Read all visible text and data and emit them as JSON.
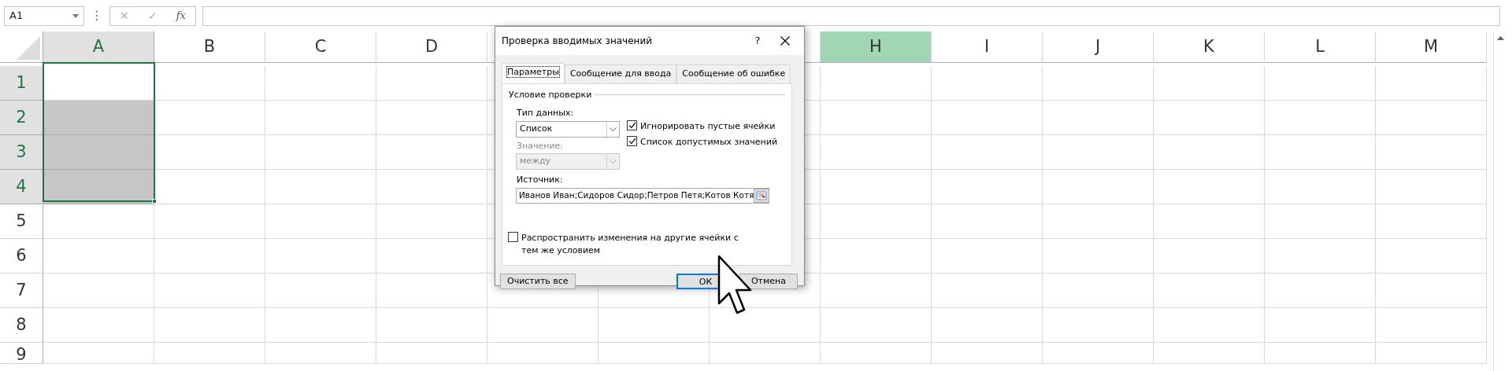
{
  "formula_bar": {
    "name_box": "A1",
    "cancel": "✕",
    "enter": "✓",
    "function": "fx",
    "more": "⋮"
  },
  "sheet": {
    "columns": [
      {
        "label": "A",
        "selected": true,
        "highlighted": false
      },
      {
        "label": "B",
        "selected": false,
        "highlighted": false
      },
      {
        "label": "C",
        "selected": false,
        "highlighted": false
      },
      {
        "label": "D",
        "selected": false,
        "highlighted": false
      },
      {},
      {},
      {
        "selected": false,
        "highlighted": false
      },
      {
        "label": "H",
        "selected": false,
        "highlighted": true
      },
      {
        "label": "I",
        "selected": false,
        "highlighted": false
      },
      {
        "label": "J",
        "selected": false,
        "highlighted": false
      },
      {
        "label": "K",
        "selected": false,
        "highlighted": false
      },
      {
        "label": "L",
        "selected": false,
        "highlighted": false
      },
      {
        "label": "M",
        "selected": false,
        "highlighted": false
      }
    ],
    "rows": [
      {
        "label": "1",
        "selected": true,
        "active": true
      },
      {
        "label": "2",
        "selected": true,
        "active": false
      },
      {
        "label": "3",
        "selected": true,
        "active": false
      },
      {
        "label": "4",
        "selected": true,
        "active": false
      },
      {
        "label": "5",
        "selected": false,
        "active": false
      },
      {
        "label": "6",
        "selected": false,
        "active": false
      },
      {
        "label": "7",
        "selected": false,
        "active": false
      },
      {
        "label": "8",
        "selected": false,
        "active": false
      },
      {
        "label": "9",
        "selected": false,
        "active": false
      }
    ]
  },
  "dialog": {
    "title": "Проверка вводимых значений",
    "help": "?",
    "tabs": [
      {
        "label": "Параметры",
        "selected": true
      },
      {
        "label": "Сообщение для ввода",
        "selected": false
      },
      {
        "label": "Сообщение об ошибке",
        "selected": false
      }
    ],
    "group_title": "Условие проверки",
    "type_label": "Тип данных:",
    "type_value": "Список",
    "type_disabled": false,
    "value_label": "Значение:",
    "value_value": "между",
    "value_disabled": true,
    "checkboxes": [
      {
        "label": "Игнорировать пустые ячейки",
        "checked": true
      },
      {
        "label": "Список допустимых значений",
        "checked": true
      }
    ],
    "source_label": "Источник:",
    "source_value": "Иванов Иван;Сидоров Сидор;Петров Петя;Котов Котя",
    "spread": {
      "label": "Распространить изменения на другие ячейки с тем же условием",
      "checked": false
    },
    "buttons": [
      {
        "label": "Очистить все",
        "default": false
      },
      {
        "label": "ОК",
        "default": true
      },
      {
        "label": "Отмена",
        "default": false
      }
    ]
  }
}
